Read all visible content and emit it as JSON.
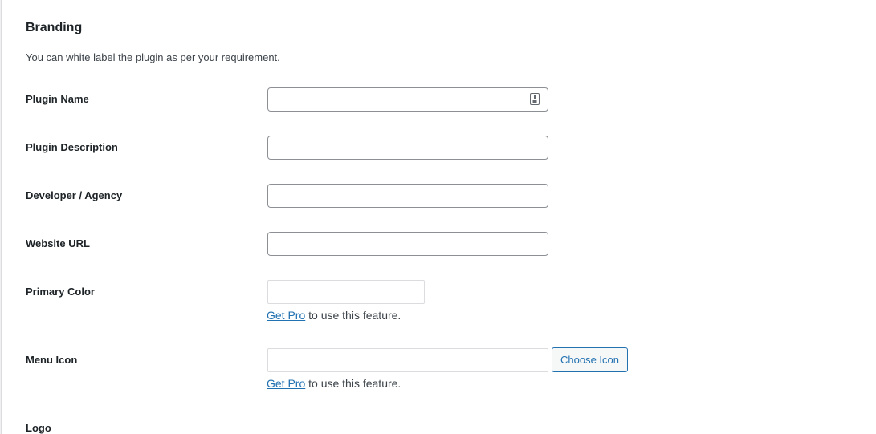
{
  "section": {
    "title": "Branding",
    "description": "You can white label the plugin as per your requirement."
  },
  "fields": {
    "plugin_name": {
      "label": "Plugin Name",
      "value": ""
    },
    "plugin_description": {
      "label": "Plugin Description",
      "value": ""
    },
    "developer_agency": {
      "label": "Developer / Agency",
      "value": ""
    },
    "website_url": {
      "label": "Website URL",
      "value": ""
    },
    "primary_color": {
      "label": "Primary Color",
      "value": ""
    },
    "menu_icon": {
      "label": "Menu Icon",
      "value": "",
      "button_label": "Choose Icon"
    },
    "logo": {
      "label": "Logo"
    }
  },
  "pro_notice": {
    "link_text": "Get Pro",
    "suffix": " to use this feature."
  },
  "colors": {
    "link": "#2271b1",
    "input_border": "#8c8f94",
    "disabled_border": "#dcdcde"
  },
  "icons": {
    "autofill": "password-manager-icon"
  }
}
